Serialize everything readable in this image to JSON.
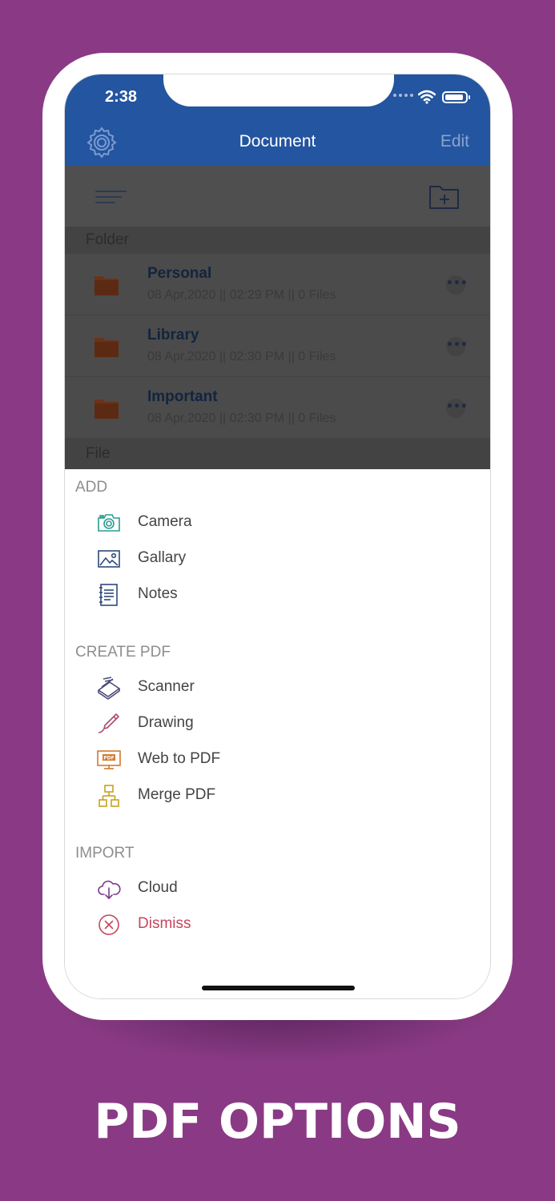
{
  "status_bar": {
    "time": "2:38"
  },
  "header": {
    "title": "Document",
    "edit_label": "Edit"
  },
  "list": {
    "folder_section": "Folder",
    "file_section": "File",
    "folders": [
      {
        "name": "Personal",
        "meta": "08 Apr,2020 || 02:29 PM || 0 Files",
        "more": "•••"
      },
      {
        "name": "Library",
        "meta": "08 Apr,2020 || 02:30 PM || 0 Files",
        "more": "•••"
      },
      {
        "name": "Important",
        "meta": "08 Apr,2020 || 02:30 PM || 0 Files",
        "more": "•••"
      }
    ]
  },
  "sheet": {
    "add_label": "ADD",
    "add_items": [
      {
        "label": "Camera",
        "icon": "camera-icon"
      },
      {
        "label": "Gallary",
        "icon": "image-icon"
      },
      {
        "label": "Notes",
        "icon": "notes-icon"
      }
    ],
    "create_label": "CREATE PDF",
    "create_items": [
      {
        "label": "Scanner",
        "icon": "scanner-icon"
      },
      {
        "label": "Drawing",
        "icon": "pen-icon"
      },
      {
        "label": "Web to PDF",
        "icon": "web-pdf-icon"
      },
      {
        "label": "Merge PDF",
        "icon": "merge-icon"
      }
    ],
    "import_label": "IMPORT",
    "import_items": [
      {
        "label": "Cloud",
        "icon": "cloud-download-icon"
      },
      {
        "label": "Dismiss",
        "icon": "close-circle-icon"
      }
    ]
  },
  "colors": {
    "background": "#8a3a84",
    "header": "#2355a0",
    "dismiss": "#c8445d",
    "folder": "#6b3216"
  },
  "caption": "PDF OPTIONS"
}
